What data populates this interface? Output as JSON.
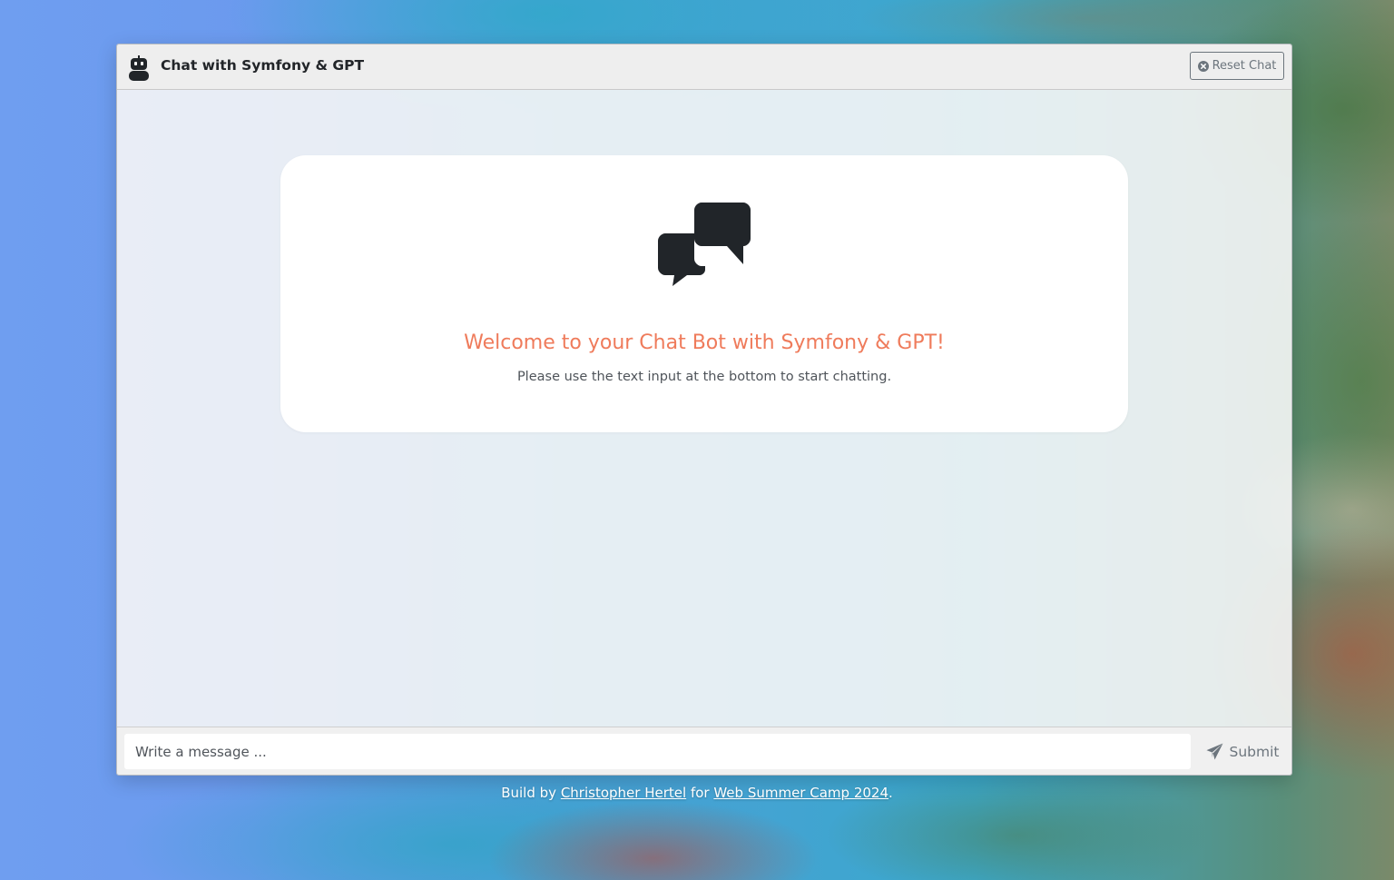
{
  "header": {
    "title": "Chat with Symfony & GPT",
    "reset_label": "Reset Chat",
    "robot_icon": "robot-icon",
    "reset_icon": "x-circle-icon"
  },
  "welcome": {
    "icon": "chat-bubbles-icon",
    "title": "Welcome to your Chat Bot with Symfony & GPT!",
    "subtitle": "Please use the text input at the bottom to start chatting."
  },
  "composer": {
    "placeholder": "Write a message ...",
    "value": "",
    "submit_label": "Submit",
    "submit_icon": "paper-plane-icon"
  },
  "credits": {
    "prefix": "Build by",
    "author": "Christopher Hertel",
    "middle": "for",
    "event": "Web Summer Camp 2024",
    "suffix": "."
  },
  "colors": {
    "accent": "#ef7b5b",
    "icon_dark": "#212529",
    "muted": "#6c757d"
  }
}
